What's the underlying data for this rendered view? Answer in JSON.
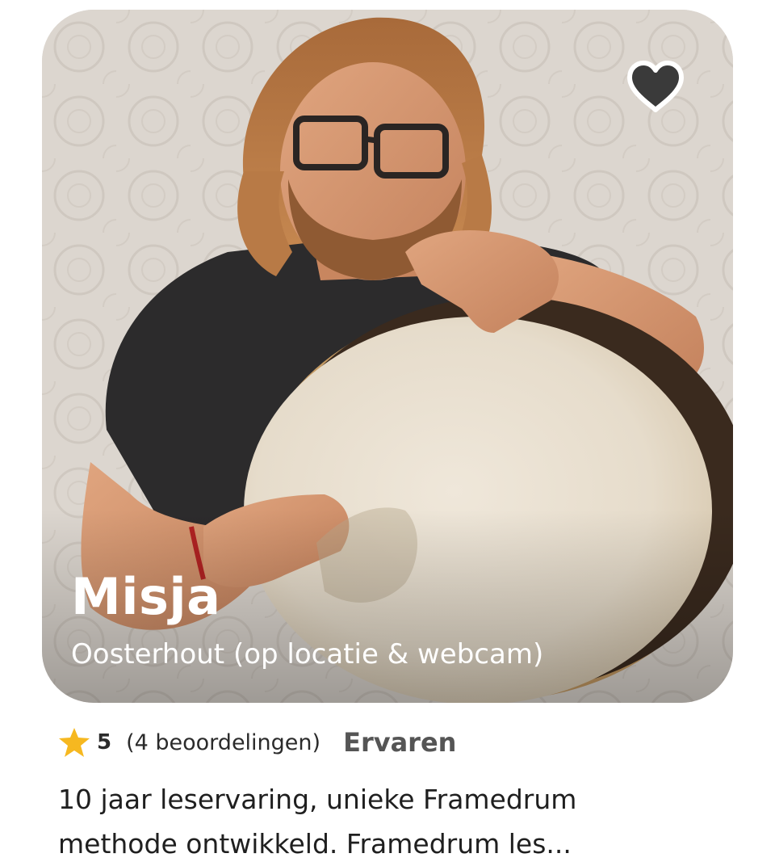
{
  "teacher": {
    "name": "Misja",
    "location": "Oosterhout (op locatie & webcam)"
  },
  "favorite": {
    "icon": "heart-icon",
    "fill_color": "#3a3a3a",
    "outline_color": "#ffffff"
  },
  "rating": {
    "icon": "star-icon",
    "star_color": "#f6b820",
    "score": "5",
    "reviews_text": "(4 beoordelingen)",
    "level": "Ervaren"
  },
  "description": {
    "line1": "10 jaar leservaring, unieke Framedrum",
    "line2": "methode ontwikkeld. Framedrum les..."
  }
}
